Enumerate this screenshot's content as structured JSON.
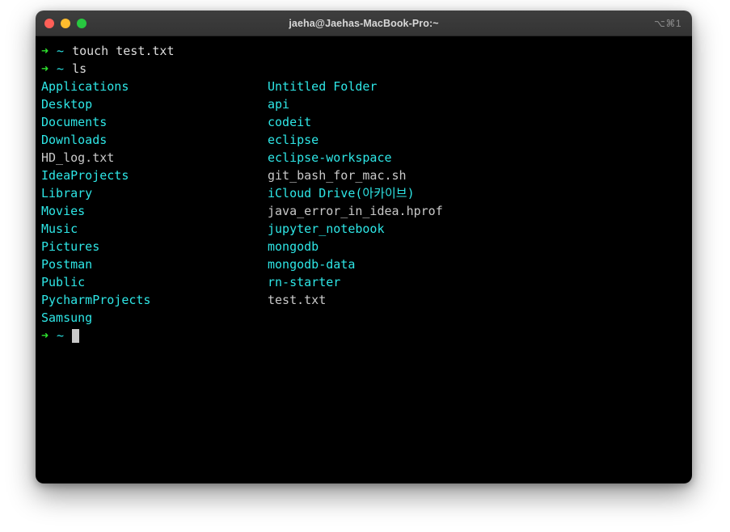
{
  "window": {
    "title": "jaeha@Jaehas-MacBook-Pro:~",
    "shortcut": "⌥⌘1",
    "traffic_lights": {
      "close": "close-button",
      "minimize": "minimize-button",
      "maximize": "maximize-button"
    },
    "colors": {
      "titlebar_bg": "#3a3a3a",
      "title_text": "#d7d7d7",
      "shortcut_text": "#8d8d8d",
      "terminal_bg": "#000000",
      "close": "#ff5f57",
      "minimize": "#febc2e",
      "maximize": "#28c840",
      "prompt_arrow": "#2ee12e",
      "prompt_tilde": "#29e0e0",
      "directory": "#2ee6e6",
      "file": "#c9c9c9",
      "command_text": "#dcdcdc",
      "cursor": "#c8c8c8"
    }
  },
  "terminal": {
    "prompt": {
      "arrow": "➜",
      "path": "~"
    },
    "commands": [
      {
        "text": "touch test.txt"
      },
      {
        "text": "ls"
      }
    ],
    "listing": [
      {
        "left": {
          "name": "Applications",
          "type": "dir"
        },
        "right": {
          "name": "Untitled Folder",
          "type": "dir"
        }
      },
      {
        "left": {
          "name": "Desktop",
          "type": "dir"
        },
        "right": {
          "name": "api",
          "type": "dir"
        }
      },
      {
        "left": {
          "name": "Documents",
          "type": "dir"
        },
        "right": {
          "name": "codeit",
          "type": "dir"
        }
      },
      {
        "left": {
          "name": "Downloads",
          "type": "dir"
        },
        "right": {
          "name": "eclipse",
          "type": "dir"
        }
      },
      {
        "left": {
          "name": "HD_log.txt",
          "type": "file"
        },
        "right": {
          "name": "eclipse-workspace",
          "type": "dir"
        }
      },
      {
        "left": {
          "name": "IdeaProjects",
          "type": "dir"
        },
        "right": {
          "name": "git_bash_for_mac.sh",
          "type": "file"
        }
      },
      {
        "left": {
          "name": "Library",
          "type": "dir"
        },
        "right": {
          "name": "iCloud Drive(아카이브)",
          "type": "dir"
        }
      },
      {
        "left": {
          "name": "Movies",
          "type": "dir"
        },
        "right": {
          "name": "java_error_in_idea.hprof",
          "type": "file"
        }
      },
      {
        "left": {
          "name": "Music",
          "type": "dir"
        },
        "right": {
          "name": "jupyter_notebook",
          "type": "dir"
        }
      },
      {
        "left": {
          "name": "Pictures",
          "type": "dir"
        },
        "right": {
          "name": "mongodb",
          "type": "dir"
        }
      },
      {
        "left": {
          "name": "Postman",
          "type": "dir"
        },
        "right": {
          "name": "mongodb-data",
          "type": "dir"
        }
      },
      {
        "left": {
          "name": "Public",
          "type": "dir"
        },
        "right": {
          "name": "rn-starter",
          "type": "dir"
        }
      },
      {
        "left": {
          "name": "PycharmProjects",
          "type": "dir"
        },
        "right": {
          "name": "test.txt",
          "type": "file"
        }
      },
      {
        "left": {
          "name": "Samsung",
          "type": "dir"
        },
        "right": {
          "name": "",
          "type": "file"
        }
      }
    ]
  }
}
